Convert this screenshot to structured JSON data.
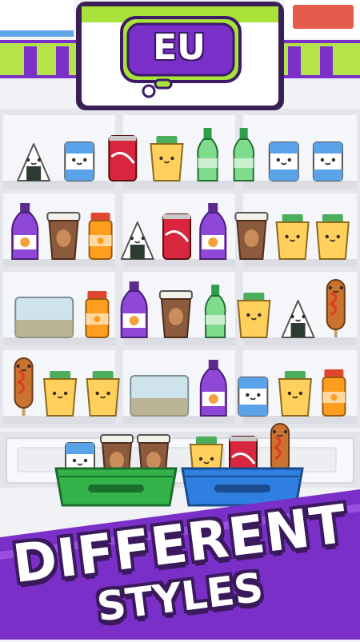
{
  "logo": {
    "text": "EU"
  },
  "caption": {
    "line1": "DIFFERENT",
    "line2": "STYLES"
  },
  "colors": {
    "purple": "#7b2fc9",
    "lime": "#a8e23a",
    "basket_green": "#34b34a",
    "basket_blue": "#2f7fe0",
    "shelf": "#e9eaee"
  },
  "shelf_grid": [
    [
      "onigiri",
      "milk",
      "cola-can",
      "yogurt",
      "soda-bottle",
      "soda-bottle",
      "milk",
      "milk"
    ],
    [
      "grape-bottle",
      "coffee-cup",
      "juice-bottle",
      "onigiri",
      "cola-can",
      "grape-bottle",
      "coffee-cup",
      "yogurt",
      "yogurt"
    ],
    [
      "container",
      "juice-bottle",
      "grape-bottle",
      "coffee-cup",
      "soda-bottle",
      "yogurt",
      "onigiri",
      "corndog"
    ],
    [
      "corndog",
      "yogurt",
      "yogurt",
      "container",
      "grape-bottle",
      "milk",
      "yogurt",
      "juice-bottle"
    ]
  ],
  "baskets": [
    {
      "color": "green",
      "items": [
        "milk",
        "coffee-cup",
        "coffee-cup"
      ]
    },
    {
      "color": "blue",
      "items": [
        "yogurt",
        "cola-can",
        "corndog"
      ]
    }
  ]
}
